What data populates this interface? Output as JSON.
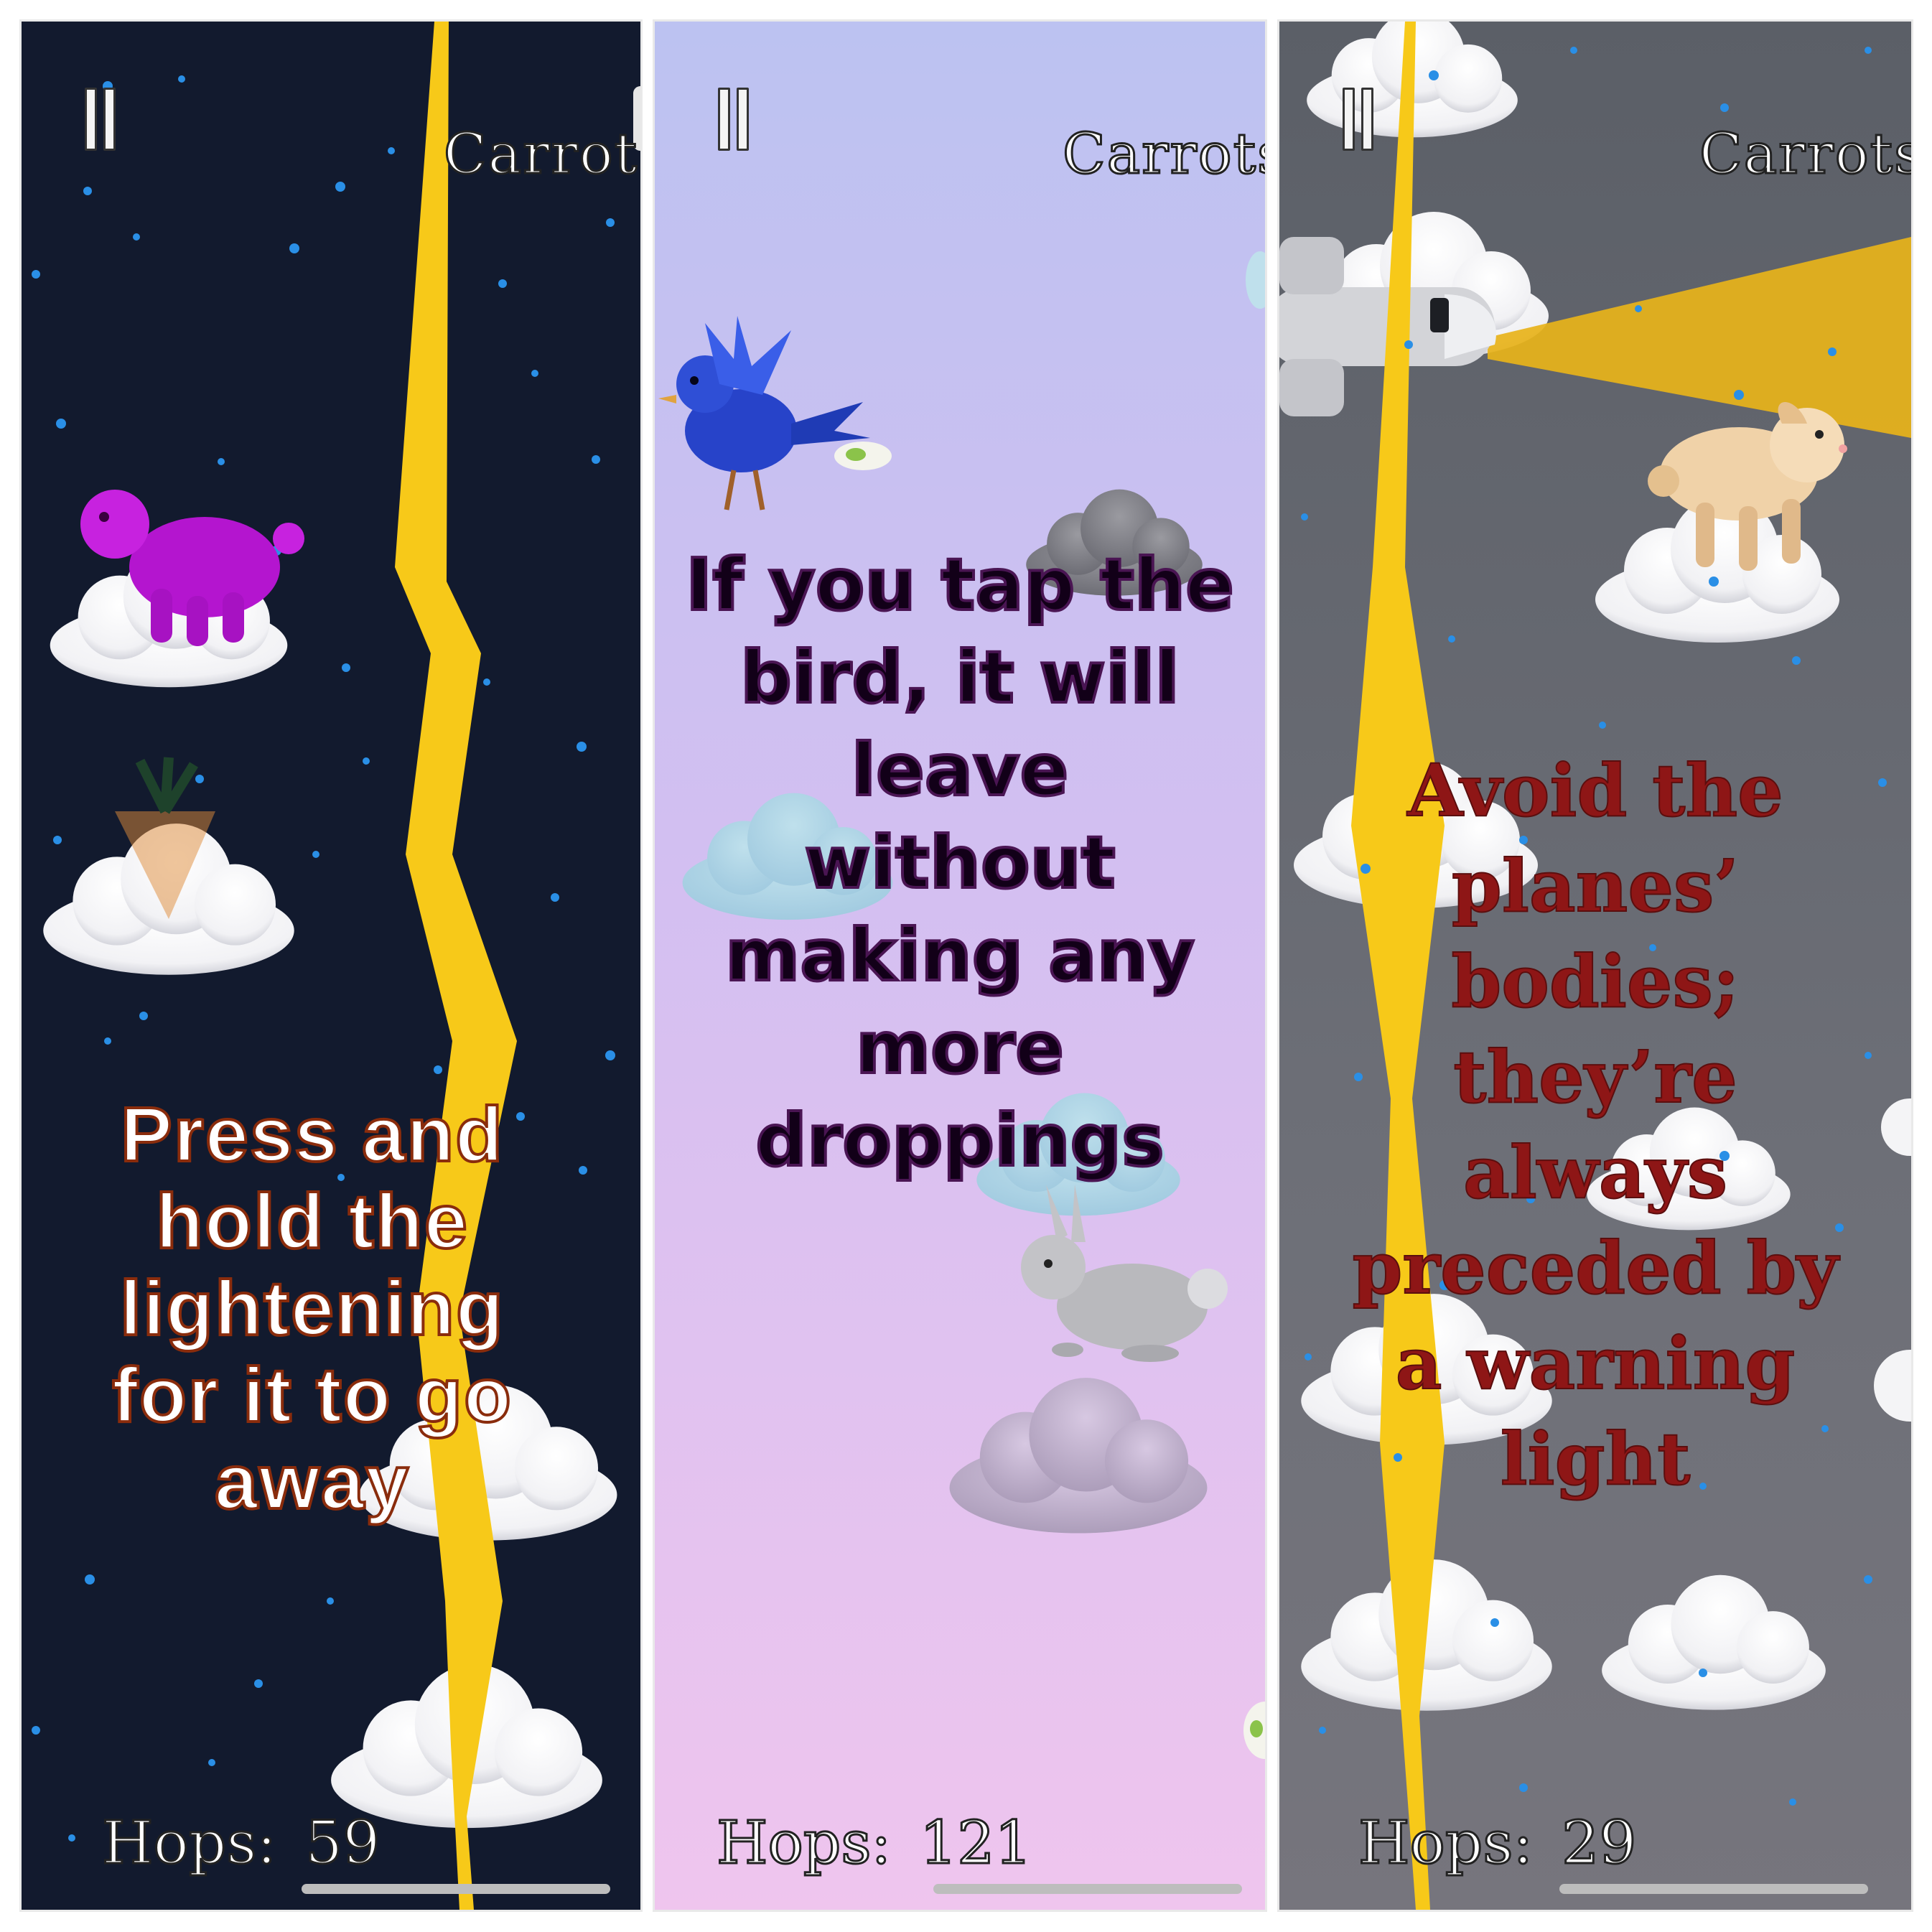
{
  "screens": [
    {
      "pause_icon": "pause-icon",
      "carrots_label": "Carrots",
      "tip": "Press and hold the lightening for it to go away",
      "hops_label": "Hops:",
      "hops_value": "59",
      "colors": {
        "background": "#121a2e",
        "lightning": "#f7c919",
        "rabbit": "#b415cf",
        "tip_text": "#ffffff",
        "tip_outline": "#8a2c0c"
      }
    },
    {
      "pause_icon": "pause-icon",
      "carrots_label": "Carrots",
      "tip": "If you tap the bird, it will leave without making any more droppings",
      "hops_label": "Hops:",
      "hops_value": "121",
      "colors": {
        "background_top": "#bcc2f1",
        "background_bottom": "#efc5ee",
        "bird": "#2743c9",
        "rabbit": "#b9b9bd",
        "tip_text": "#120018",
        "tip_outline": "#4a1553"
      }
    },
    {
      "pause_icon": "pause-icon",
      "carrots_label": "Carrots",
      "tip": "Avoid the planes’ bodies; they’re always preceded by a warning light",
      "hops_label": "Hops:",
      "hops_value": "29",
      "colors": {
        "background": "#676a72",
        "lightning": "#f7c919",
        "warning_light": "#e8b31a",
        "rabbit": "#f0d2a8",
        "tip_text": "#8e1616"
      }
    }
  ]
}
